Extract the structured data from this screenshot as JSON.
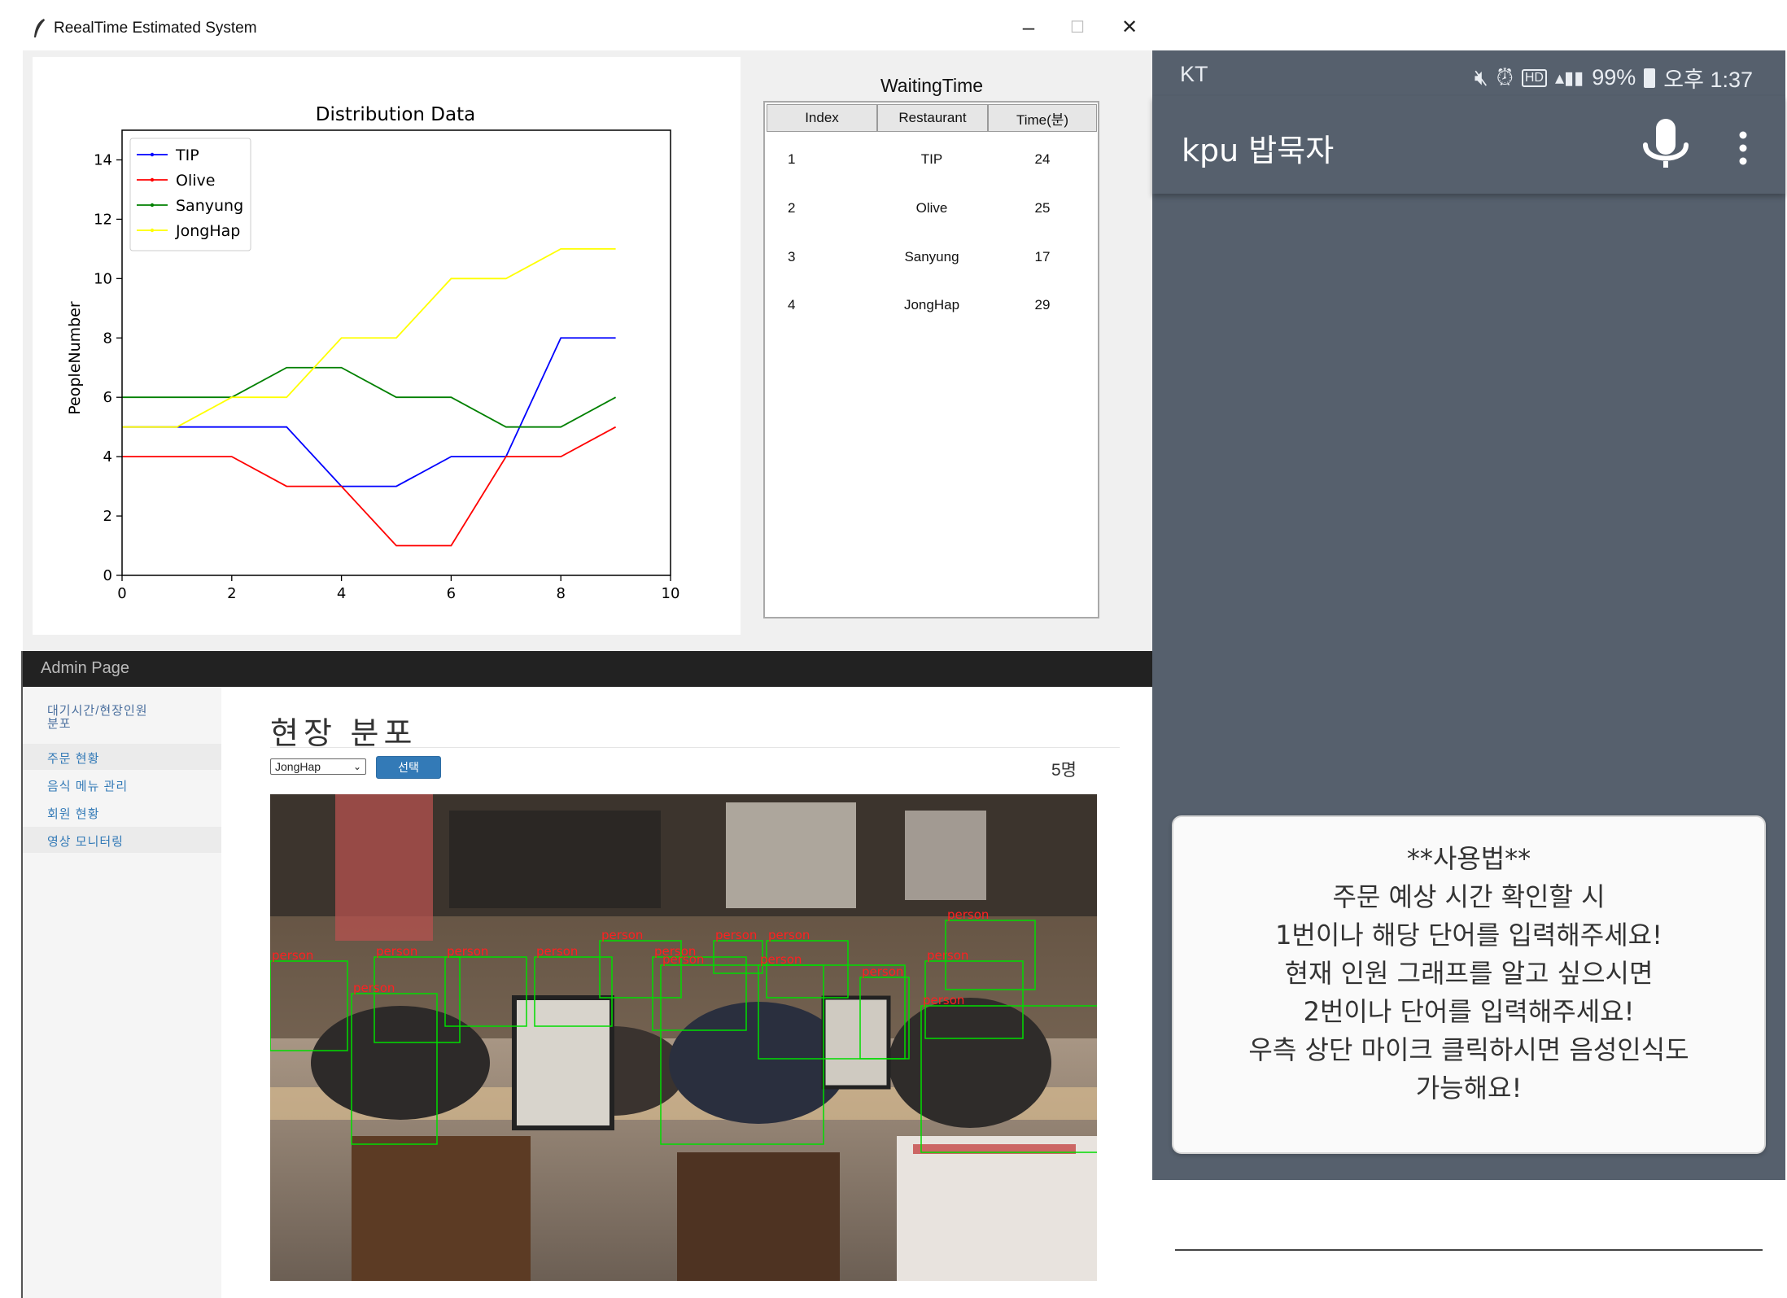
{
  "window": {
    "title": "ReealTime Estimated System",
    "minimize_glyph": "–",
    "maximize_glyph": "☐",
    "close_glyph": "✕"
  },
  "chart_data": {
    "type": "line",
    "title": "Distribution Data",
    "xlabel": "",
    "ylabel": "PeopleNumber",
    "x": [
      0,
      1,
      2,
      3,
      4,
      5,
      6,
      7,
      8,
      9
    ],
    "xlim": [
      0,
      10
    ],
    "ylim": [
      0,
      15
    ],
    "xticks": [
      0,
      2,
      4,
      6,
      8,
      10
    ],
    "yticks": [
      0,
      2,
      4,
      6,
      8,
      10,
      12,
      14
    ],
    "grid": false,
    "legend_position": "top-left",
    "series": [
      {
        "name": "TIP",
        "color": "#0000ff",
        "values": [
          5,
          5,
          5,
          5,
          3,
          3,
          4,
          4,
          8,
          8
        ]
      },
      {
        "name": "Olive",
        "color": "#ff0000",
        "values": [
          4,
          4,
          4,
          3,
          3,
          1,
          1,
          4,
          4,
          5
        ]
      },
      {
        "name": "Sanyung",
        "color": "#008000",
        "values": [
          6,
          6,
          6,
          7,
          7,
          6,
          6,
          5,
          5,
          6
        ]
      },
      {
        "name": "JongHap",
        "color": "#ffff00",
        "values": [
          5,
          5,
          6,
          6,
          8,
          8,
          10,
          10,
          11,
          11
        ]
      }
    ]
  },
  "waiting": {
    "title": "WaitingTime",
    "headers": [
      "Index",
      "Restaurant",
      "Time(분)"
    ],
    "rows": [
      [
        "1",
        "TIP",
        "24"
      ],
      [
        "2",
        "Olive",
        "25"
      ],
      [
        "3",
        "Sanyung",
        "17"
      ],
      [
        "4",
        "JongHap",
        "29"
      ]
    ]
  },
  "admin": {
    "brand": "Admin Page",
    "menu": [
      "대기시간/현장인원",
      "분포",
      "주문 현황",
      "음식 메뉴 관리",
      "회원 현황",
      "영상 모니터링"
    ],
    "heading": "현장 분포",
    "select_value": "JongHap",
    "button_label": "선택",
    "count": "5명",
    "detection_label": "person",
    "detection_color": "#00dd00",
    "detection_text_color": "#ff2020"
  },
  "phone": {
    "carrier": "KT",
    "battery": "99%",
    "time": "오후 1:37",
    "app_name": "kpu 밥묵자",
    "bubble_lines": [
      "**사용법**",
      "주문 예상 시간 확인할 시",
      "1번이나 해당 단어를 입력해주세요!",
      "현재 인원 그래프를 알고 싶으시면",
      "2번이나 단어를 입력해주세요!",
      "우측 상단 마이크 클릭하시면 음성인식도",
      "가능해요!"
    ],
    "header_color": "#56606d"
  }
}
